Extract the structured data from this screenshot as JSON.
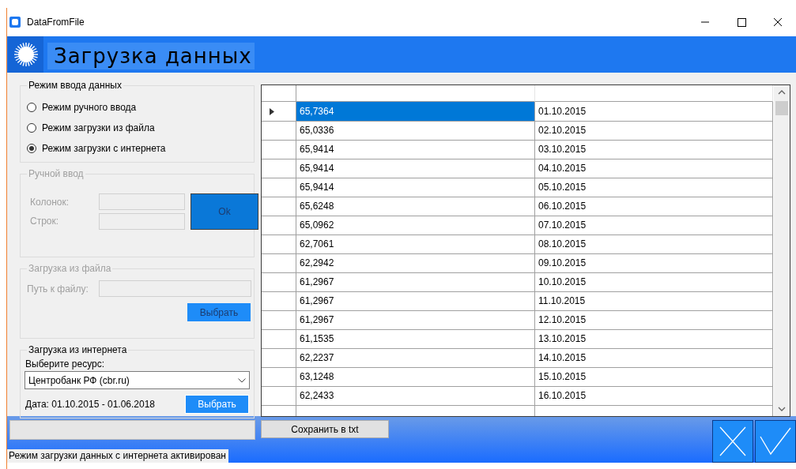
{
  "window": {
    "title": "DataFromFile"
  },
  "header": {
    "title": "Загрузка данных"
  },
  "input_mode": {
    "title": "Режим ввода данных",
    "options": [
      {
        "label": "Режим ручного ввода",
        "selected": false
      },
      {
        "label": "Режим загрузки из файла",
        "selected": false
      },
      {
        "label": "Режим загрузки с интернета",
        "selected": true
      }
    ]
  },
  "manual_input": {
    "title": "Ручной ввод",
    "disabled": true,
    "columns_label": "Колонок:",
    "rows_label": "Строк:",
    "ok_button": "Ok"
  },
  "file_load": {
    "title": "Загрузка из файла",
    "disabled": true,
    "path_label": "Путь к файлу:",
    "browse_button": "Выбрать"
  },
  "internet_load": {
    "title": "Загрузка из интернета",
    "disabled": false,
    "resource_label": "Выберите ресурс:",
    "resource": "Центробанк РФ (cbr.ru)",
    "date_range": "Дата: 01.10.2015 - 01.06.2018",
    "select_button": "Выбрать"
  },
  "table": {
    "rows": [
      {
        "values": [
          "65,7364",
          "01.10.2015"
        ],
        "selected": true
      },
      {
        "values": [
          "65,0336",
          "02.10.2015"
        ],
        "selected": false
      },
      {
        "values": [
          "65,9414",
          "03.10.2015"
        ],
        "selected": false
      },
      {
        "values": [
          "65,9414",
          "04.10.2015"
        ],
        "selected": false
      },
      {
        "values": [
          "65,9414",
          "05.10.2015"
        ],
        "selected": false
      },
      {
        "values": [
          "65,6248",
          "06.10.2015"
        ],
        "selected": false
      },
      {
        "values": [
          "65,0962",
          "07.10.2015"
        ],
        "selected": false
      },
      {
        "values": [
          "62,7061",
          "08.10.2015"
        ],
        "selected": false
      },
      {
        "values": [
          "62,2942",
          "09.10.2015"
        ],
        "selected": false
      },
      {
        "values": [
          "61,2967",
          "10.10.2015"
        ],
        "selected": false
      },
      {
        "values": [
          "61,2967",
          "11.10.2015"
        ],
        "selected": false
      },
      {
        "values": [
          "61,2967",
          "12.10.2015"
        ],
        "selected": false
      },
      {
        "values": [
          "61,1535",
          "13.10.2015"
        ],
        "selected": false
      },
      {
        "values": [
          "62,2237",
          "14.10.2015"
        ],
        "selected": false
      },
      {
        "values": [
          "63,1248",
          "15.10.2015"
        ],
        "selected": false
      },
      {
        "values": [
          "62,2433",
          "16.10.2015"
        ],
        "selected": false
      }
    ]
  },
  "save_button": "Сохранить в txt",
  "status_bar": "Режим загрузки данных с интернета активирован"
}
